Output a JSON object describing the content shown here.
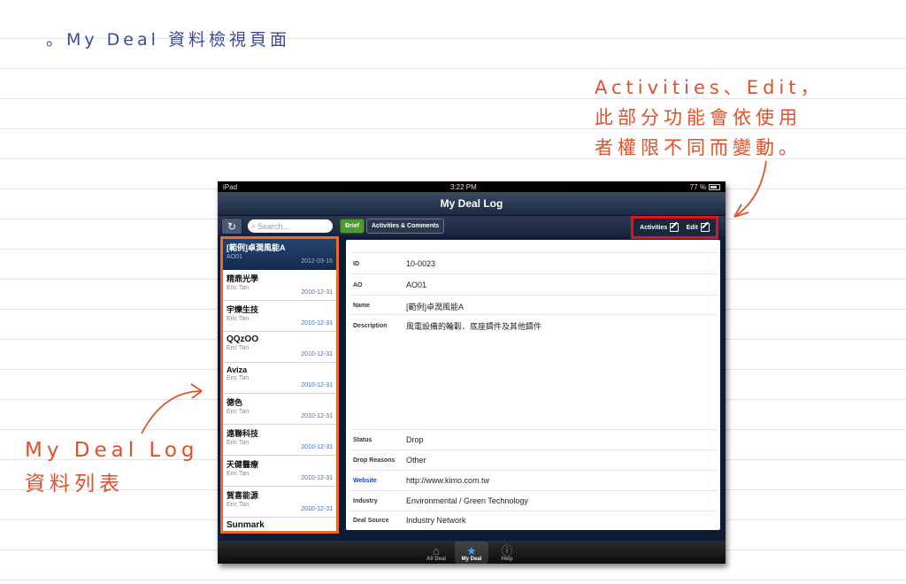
{
  "page_title": "。My Deal 資料檢視頁面",
  "notes": {
    "right": [
      "Activities、Edit，",
      "此部分功能會依使用",
      "者權限不同而變動。"
    ],
    "left": [
      "My Deal Log",
      "資料列表"
    ]
  },
  "status_bar": {
    "device": "iPad",
    "time": "3:22 PM",
    "battery": "77 %"
  },
  "nav_title": "My Deal Log",
  "toolbar": {
    "search_placeholder": "Search...",
    "brief_label": "Brief",
    "activities_comments_label": "Activities & Comments",
    "activities_label": "Activities",
    "edit_label": "Edit"
  },
  "list_items": [
    {
      "name": "[範例]卓潤風能A",
      "sub": "AO01",
      "date": "2012-03-16"
    },
    {
      "name": "精鼎光學",
      "sub": "Eric Tan",
      "date": "2010-12-31"
    },
    {
      "name": "宇爍生技",
      "sub": "Eric Tan",
      "date": "2010-12-31"
    },
    {
      "name": "QQzOO",
      "sub": "Eric Tan",
      "date": "2010-12-31"
    },
    {
      "name": "Aviza",
      "sub": "Eric Tan",
      "date": "2010-12-31"
    },
    {
      "name": "德色",
      "sub": "Eric Tan",
      "date": "2010-12-31"
    },
    {
      "name": "遠聯科技",
      "sub": "Eric Tan",
      "date": "2010-12-31"
    },
    {
      "name": "天健醫療",
      "sub": "Eric Tan",
      "date": "2010-12-31"
    },
    {
      "name": "賀喜能源",
      "sub": "Eric Tan",
      "date": "2010-12-31"
    },
    {
      "name": "Sunmark",
      "sub": "",
      "date": ""
    }
  ],
  "detail": {
    "id_label": "ID",
    "id_value": "10-0023",
    "ao_label": "AO",
    "ao_value": "AO01",
    "name_label": "Name",
    "name_value": "[範例]卓潤風能A",
    "description_label": "Description",
    "description_value": "風電設備的輪轂、底座鑄件及其他鑄件",
    "status_label": "Status",
    "status_value": "Drop",
    "drop_reasons_label": "Drop Reasons",
    "drop_reasons_value": "Other",
    "website_label": "Website",
    "website_value": "http://www.kimo.com.tw",
    "industry_label": "Industry",
    "industry_value": "Environmental / Green Technology",
    "deal_source_label": "Deal Source",
    "deal_source_value": "Industry Network"
  },
  "tabs": [
    {
      "label": "All Deal",
      "icon": "home-icon"
    },
    {
      "label": "My Deal",
      "icon": "star-icon"
    },
    {
      "label": "Help",
      "icon": "info-icon"
    }
  ],
  "colors": {
    "annotation": "#e2502a",
    "highlight_red": "#e0141c",
    "highlight_orange": "#ef6a2a",
    "title_blue": "#3a4a9a"
  }
}
